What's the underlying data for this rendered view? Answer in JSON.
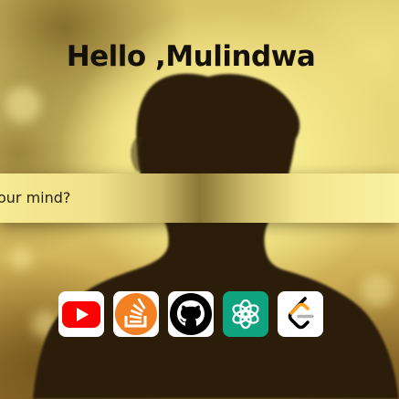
{
  "header": {
    "greeting": "Hello ,Mulindwa"
  },
  "search": {
    "visible_text": "our mind?"
  },
  "dock": {
    "apps": [
      {
        "name": "YouTube",
        "icon": "youtube-icon",
        "color": "#ff0000"
      },
      {
        "name": "Stack Overflow",
        "icon": "stackoverflow-icon",
        "color": "#f48024"
      },
      {
        "name": "GitHub",
        "icon": "github-icon",
        "color": "#000000"
      },
      {
        "name": "ChatGPT",
        "icon": "chatgpt-icon",
        "color": "#10a37f"
      },
      {
        "name": "LeetCode",
        "icon": "leetcode-icon",
        "color": "#ffa116"
      }
    ]
  },
  "theme": {
    "background_tone": "#f3e688",
    "text_color": "#151007"
  }
}
